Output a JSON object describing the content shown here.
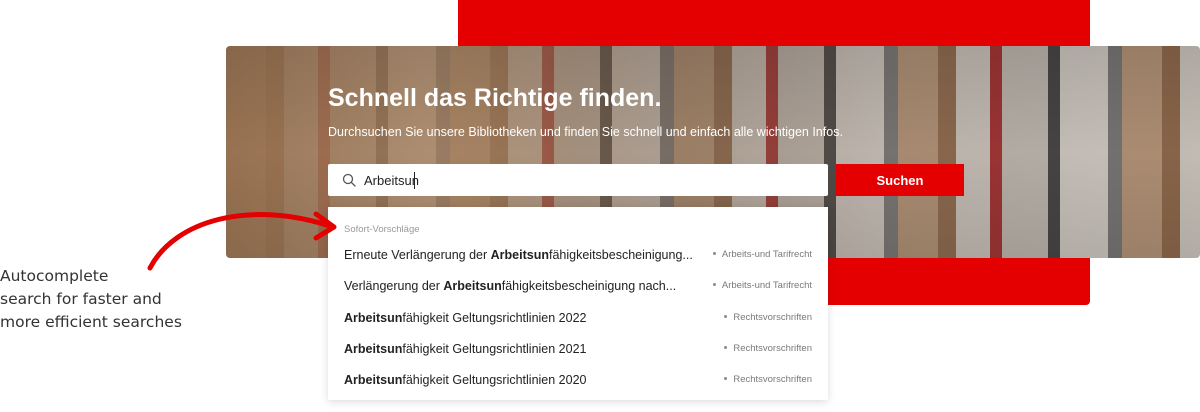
{
  "hero": {
    "title": "Schnell das Richtige finden.",
    "subtitle": "Durchsuchen Sie unsere Bibliotheken und finden Sie schnell und einfach alle wichtigen Infos."
  },
  "search": {
    "value": "Arbeitsun",
    "button_label": "Suchen",
    "icon": "search-icon"
  },
  "dropdown": {
    "heading": "Sofort-Vorschläge",
    "suggestions": [
      {
        "before": "Erneute Verlängerung der ",
        "match": "Arbeitsun",
        "after": "fähigkeitsbescheinigung...",
        "category": "Arbeits-und Tarifrecht"
      },
      {
        "before": "Verlängerung der ",
        "match": "Arbeitsun",
        "after": "fähigkeitsbescheinigung nach...",
        "category": "Arbeits-und Tarifrecht"
      },
      {
        "before": "",
        "match": "Arbeitsun",
        "after": "fähigkeit Geltungsrichtlinien 2022",
        "category": "Rechtsvorschriften"
      },
      {
        "before": "",
        "match": "Arbeitsun",
        "after": "fähigkeit Geltungsrichtlinien 2021",
        "category": "Rechtsvorschriften"
      },
      {
        "before": "",
        "match": "Arbeitsun",
        "after": "fähigkeit Geltungsrichtlinien 2020",
        "category": "Rechtsvorschriften"
      }
    ]
  },
  "annotation": {
    "lines": [
      "Autocomplete",
      "search for faster and",
      "more efficient searches"
    ]
  },
  "colors": {
    "accent": "#e40000",
    "text": "#222222",
    "muted": "#7a7a7a"
  }
}
